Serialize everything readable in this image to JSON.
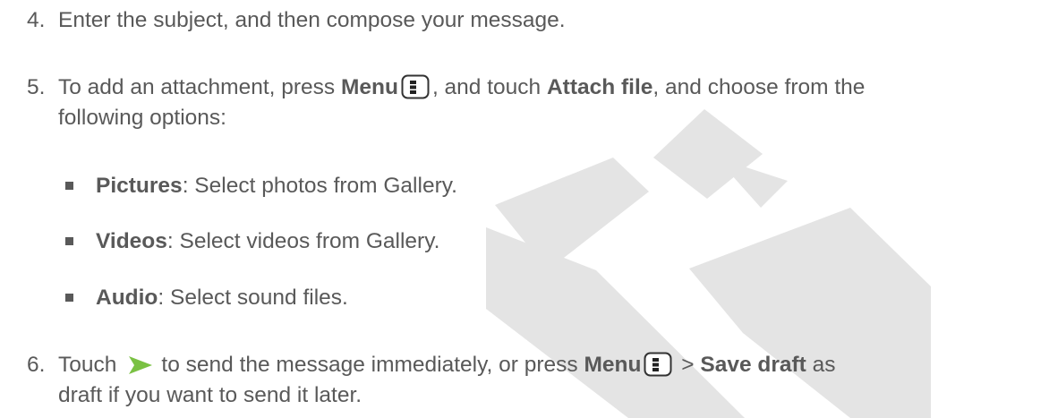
{
  "steps": [
    {
      "number": "4.",
      "text": "Enter the subject, and then compose your message."
    },
    {
      "number": "5.",
      "line1_a": "To add an attachment, press ",
      "line1_b": "Menu",
      "line1_c": ", and touch ",
      "line1_d": "Attach file",
      "line1_e": ", and choose from the",
      "line2": "following options:"
    },
    {
      "number": "6.",
      "line1_a": "Touch",
      "line1_b": "to send the message immediately, or press ",
      "line1_c": "Menu",
      "line1_d": " > ",
      "line1_e": "Save draft",
      "line1_f": " as",
      "line2": "draft if you want to send it later."
    }
  ],
  "options": [
    {
      "term": "Pictures",
      "desc": ": Select photos from Gallery."
    },
    {
      "term": "Videos",
      "desc": ": Select videos from Gallery."
    },
    {
      "term": "Audio",
      "desc": ": Select sound files."
    }
  ],
  "icons": {
    "menu": "menu-icon",
    "send": "send-icon"
  },
  "colors": {
    "text": "#595959",
    "watermark": "#e3e3e3",
    "send_icon": "#7ac143"
  }
}
